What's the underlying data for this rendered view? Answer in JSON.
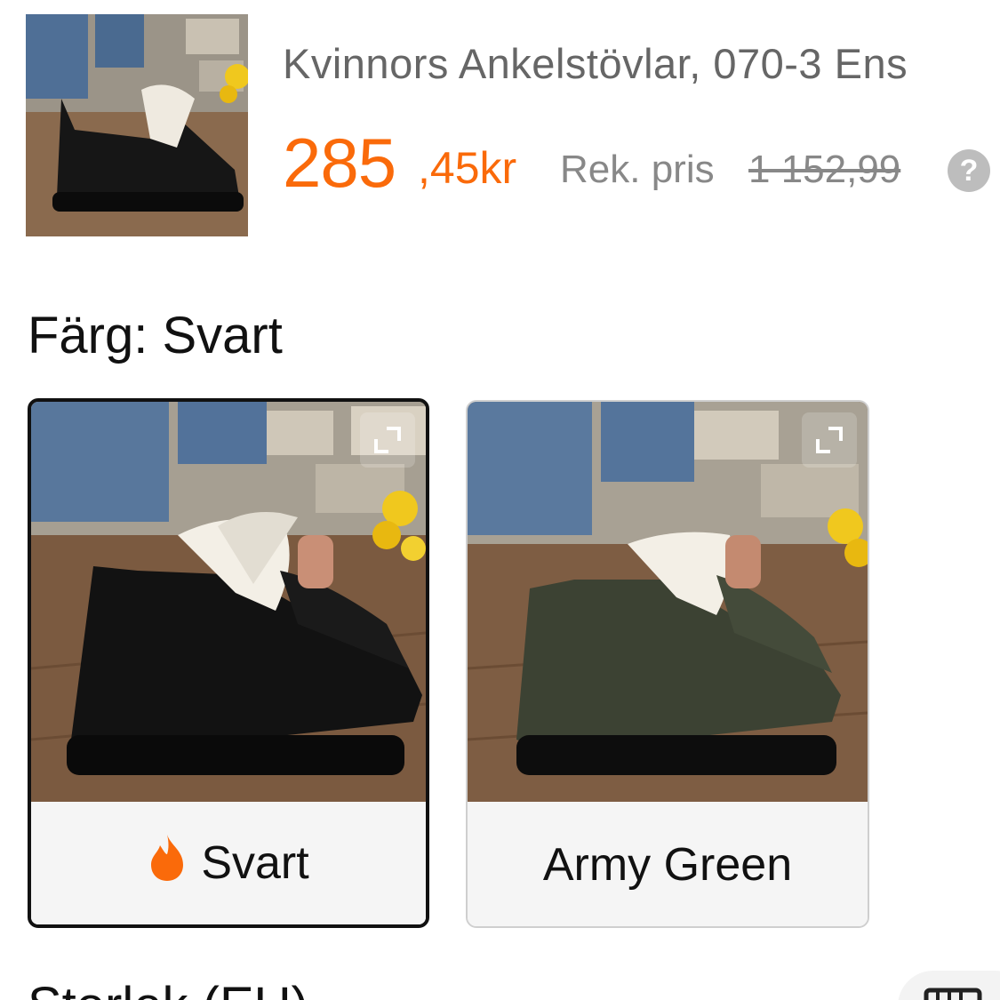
{
  "product": {
    "title": "Kvinnors Ankelstövlar, 070-3 Ens",
    "price_integer": "285",
    "price_decimal": ",45kr",
    "rek_label": "Rek. pris",
    "rek_price": "1 152,99",
    "help_symbol": "?"
  },
  "color_section": {
    "heading": "Färg: Svart",
    "options": [
      {
        "label": "Svart",
        "selected": true,
        "badge_icon": "fire-icon",
        "shoe_color": "#141414"
      },
      {
        "label": "Army Green",
        "selected": false,
        "shoe_color": "#3c4233"
      }
    ]
  },
  "size_section": {
    "heading": "Storlek (EU)"
  },
  "colors": {
    "price": "#fa6a0a",
    "muted_text": "#888888",
    "title_text": "#666666",
    "selected_border": "#111111"
  }
}
